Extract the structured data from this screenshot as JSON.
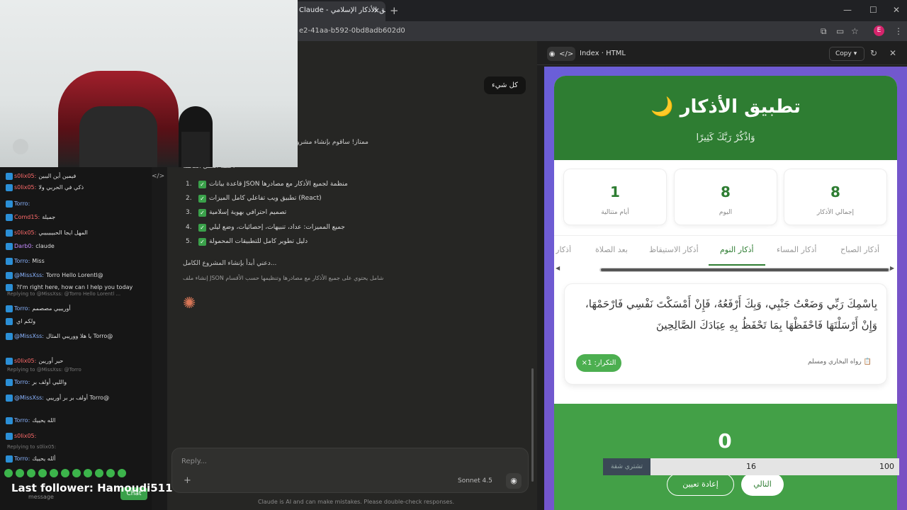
{
  "browser": {
    "tab_title": "Claude - تطبيق الأذكار الإسلامي",
    "tab_close": "×",
    "new_tab": "+",
    "url_fragment": "e2-41aa-b592-0bd8adb602d0",
    "profile_initial": "E",
    "window_controls": [
      "—",
      "☐",
      "✕"
    ]
  },
  "chat": {
    "user_message": "كل شيء",
    "intro_text": "ممتاز! سأقوم بإنشاء مشروع",
    "features_heading": ":خطة العمل الكاملة",
    "features": [
      {
        "num": "1.",
        "text": "منظمة لجميع الأذكار مع مصادرها JSON قاعدة بيانات"
      },
      {
        "num": "2.",
        "text": "(React) تطبيق ويب تفاعلي كامل الميزات"
      },
      {
        "num": "3.",
        "text": "تصميم احترافي بهوية إسلامية"
      },
      {
        "num": "4.",
        "text": "جميع المميزات: عداد، تنبيهات، إحصائيات، وضع ليلي"
      },
      {
        "num": "5.",
        "text": "دليل تطوير كامل للتطبيقات المحمولة"
      }
    ],
    "start_line": "...دعني أبدأ بإنشاء المشروع الكامل",
    "task_line": "شامل يحتوي على جميع الأذكار مع مصادرها وتنظيمها حسب الأقسام JSON إنشاء ملف",
    "reply_placeholder": "Reply...",
    "plus_label": "+",
    "model_label": "Sonnet 4.5",
    "disclaimer": "Claude is AI and can make mistakes. Please double-check responses."
  },
  "artifact": {
    "title": "Index · HTML",
    "copy_label": "Copy",
    "app": {
      "title": "تطبيق الأذكار 🌙",
      "subtitle": "وَاذْكُرْ رَبَّكَ كَثِيرًا",
      "stats": [
        {
          "value": "8",
          "label": "إجمالي الأذكار"
        },
        {
          "value": "8",
          "label": "اليوم"
        },
        {
          "value": "1",
          "label": "أيام متتالية"
        }
      ],
      "tabs": [
        "أذكار الصباح",
        "أذكار المساء",
        "أذكار النوم",
        "أذكار الاستيقاظ",
        "بعد الصلاة",
        "أذكار"
      ],
      "active_tab": "أذكار النوم",
      "zikr_text": "بِاسْمِكَ رَبِّي وَضَعْتُ جَنْبِي، وَبِكَ أَرْفَعُهُ، فَإِنْ أَمْسَكْتَ نَفْسِي فَارْحَمْهَا، وَإِنْ أَرْسَلْتَهَا فَاحْفَظْهَا بِمَا تَحْفَظُ بِهِ عِبَادَكَ الصَّالِحِينَ",
      "source": "📋 رواه البخاري ومسلم",
      "repeat_label": "التكرار: 1×",
      "counter": "0",
      "reset_label": "إعادة تعيين",
      "next_label": "التالي"
    },
    "overlay": {
      "label": "تشتري شقة",
      "mid": "16",
      "right": "100"
    }
  },
  "stream": {
    "chat_rows": [
      {
        "user": "s0lix05:",
        "msg": "فيمين أين اليبين",
        "color": "red"
      },
      {
        "user": "s0lix05:",
        "msg": "ذكي في الحربي ولا",
        "color": "red"
      },
      {
        "user": "Torro:",
        "msg": "",
        "color": "blue"
      },
      {
        "user": "Comd15:",
        "msg": "جميلة",
        "color": "red"
      },
      {
        "user": "s0lix05:",
        "msg": "المهل ايجا الحبيبيبيبي",
        "color": "red"
      },
      {
        "user": "Darb0:",
        "msg": "claude",
        "color": "purple"
      },
      {
        "user": "Torro:",
        "msg": "Miss",
        "color": "blue"
      },
      {
        "user": "@MissXss:",
        "msg": "@Torro Hello Lorentl",
        "color": "blue"
      },
      {
        "user": "",
        "msg": "I'm right here, how can I help you today?",
        "color": "blue"
      },
      {
        "user": "Torro:",
        "msg": "أوريبيي مصصمم",
        "color": "blue"
      },
      {
        "user": "",
        "msg": "ولكم اي",
        "color": "blue"
      },
      {
        "user": "@MissXss:",
        "msg": "@Torro يا هلا ووريبي المثال",
        "color": "blue"
      },
      {
        "user": "s0lix05:",
        "msg": "حير أوريين",
        "color": "red"
      },
      {
        "user": "Torro:",
        "msg": "والليي أولف بر",
        "color": "blue"
      },
      {
        "user": "@MissXss:",
        "msg": "@Torro أولف بر بر أوريبي",
        "color": "blue"
      },
      {
        "user": "Torro:",
        "msg": "الله يحييك",
        "color": "blue"
      },
      {
        "user": "s0lix05:",
        "msg": "",
        "color": "red"
      },
      {
        "user": "Torro:",
        "msg": "ألله يحييك",
        "color": "blue"
      }
    ],
    "reply_hint_1": "Replying to @MissXss: @Torro Hello Lorentl ...",
    "reply_hint_2": "Replying to @MissXss: @Torro",
    "reply_hint_3": "Replying to s0lix05:",
    "follower_text": "Last follower: Hamoudi511",
    "message_placeholder": "message",
    "chat_button": "Chat"
  }
}
